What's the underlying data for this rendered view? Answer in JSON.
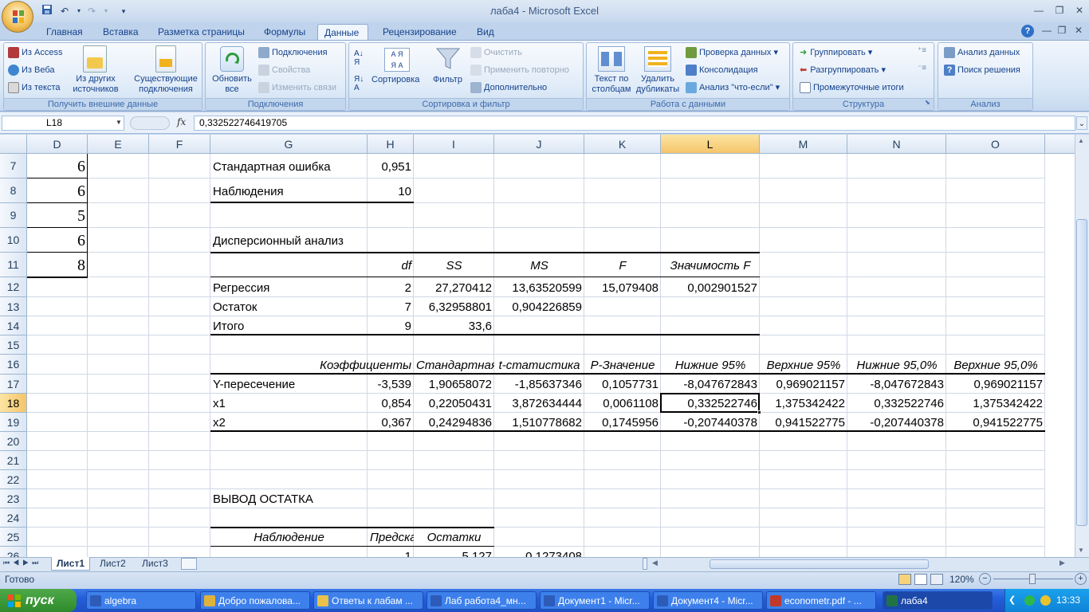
{
  "window": {
    "title": "лаба4 - Microsoft Excel"
  },
  "tabs": [
    "Главная",
    "Вставка",
    "Разметка страницы",
    "Формулы",
    "Данные",
    "Рецензирование",
    "Вид"
  ],
  "active_tab": "Данные",
  "ribbon": {
    "get_external": {
      "label": "Получить внешние данные",
      "access": "Из Access",
      "web": "Из Веба",
      "text": "Из текста",
      "other": "Из других источников",
      "existing": "Существующие подключения"
    },
    "connections": {
      "label": "Подключения",
      "refresh": "Обновить все",
      "conns": "Подключения",
      "props": "Свойства",
      "edit_links": "Изменить связи"
    },
    "sort_filter": {
      "label": "Сортировка и фильтр",
      "sort": "Сортировка",
      "filter": "Фильтр",
      "clear": "Очистить",
      "reapply": "Применить повторно",
      "advanced": "Дополнительно"
    },
    "data_tools": {
      "label": "Работа с данными",
      "text_cols": "Текст по столбцам",
      "remove_dup": "Удалить дубликаты",
      "validation": "Проверка данных",
      "consolidate": "Консолидация",
      "whatif": "Анализ \"что-если\""
    },
    "outline": {
      "label": "Структура",
      "group": "Группировать",
      "ungroup": "Разгруппировать",
      "subtotal": "Промежуточные итоги"
    },
    "analysis": {
      "label": "Анализ",
      "data_analysis": "Анализ данных",
      "solver": "Поиск решения"
    }
  },
  "formula_bar": {
    "name_box": "L18",
    "fx": "fx",
    "formula": "0,332522746419705"
  },
  "columns": [
    "D",
    "E",
    "F",
    "G",
    "H",
    "I",
    "J",
    "K",
    "L",
    "M",
    "N",
    "O"
  ],
  "rows": [
    "7",
    "8",
    "9",
    "10",
    "11",
    "12",
    "13",
    "14",
    "15",
    "16",
    "17",
    "18",
    "19",
    "20",
    "21",
    "22",
    "23",
    "24",
    "25",
    "26"
  ],
  "cells": {
    "d7": "6",
    "d8": "6",
    "d9": "5",
    "d10": "6",
    "d11": "8",
    "g7": "Стандартная ошибка",
    "h7": "0,951",
    "g8": "Наблюдения",
    "h8": "10",
    "g10": "Дисперсионный анализ",
    "h11": "df",
    "i11": "SS",
    "j11": "MS",
    "k11": "F",
    "l11": "Значимость F",
    "g12": "Регрессия",
    "h12": "2",
    "i12": "27,270412",
    "j12": "13,63520599",
    "k12": "15,079408",
    "l12": "0,002901527",
    "g13": "Остаток",
    "h13": "7",
    "i13": "6,32958801",
    "j13": "0,904226859",
    "g14": "Итого",
    "h14": "9",
    "i14": "33,6",
    "g16": "Коэффициенты",
    "h16": "",
    "i16": "Стандартная ошибка",
    "j16": "t-статистика",
    "k16": "P-Значение",
    "l16": "Нижние 95%",
    "m16": "Верхние 95%",
    "n16": "Нижние 95,0%",
    "o16": "Верхние 95,0%",
    "g17": "Y-пересечение",
    "h17": "-3,539",
    "i17": "1,90658072",
    "j17": "-1,85637346",
    "k17": "0,1057731",
    "l17": "-8,047672843",
    "m17": "0,969021157",
    "n17": "-8,047672843",
    "o17": "0,969021157",
    "g18": "x1",
    "h18": "0,854",
    "i18": "0,22050431",
    "j18": "3,872634444",
    "k18": "0,0061108",
    "l18": "0,332522746",
    "m18": "1,375342422",
    "n18": "0,332522746",
    "o18": "1,375342422",
    "g19": "x2",
    "h19": "0,367",
    "i19": "0,24294836",
    "j19": "1,510778682",
    "k19": "0,1745956",
    "l19": "-0,207440378",
    "m19": "0,941522775",
    "n19": "-0,207440378",
    "o19": "0,941522775",
    "g23": "ВЫВОД ОСТАТКА",
    "g25": "Наблюдение",
    "h25": "Предсказанное Y",
    "i25": "Остатки",
    "h26": "1",
    "i26": "5,127",
    "j26": "0,1273408"
  },
  "sheets": [
    "Лист1",
    "Лист2",
    "Лист3"
  ],
  "active_sheet": "Лист1",
  "status": {
    "ready": "Готово",
    "zoom": "120%"
  },
  "taskbar": {
    "start": "пуск",
    "tasks": [
      "algebra",
      "Добро пожалова...",
      "Ответы к лабам ...",
      "Лаб работа4_мн...",
      "Документ1 - Micr...",
      "Документ4 - Micr...",
      "econometr.pdf - ...",
      "лаба4"
    ],
    "clock": "13:33"
  }
}
